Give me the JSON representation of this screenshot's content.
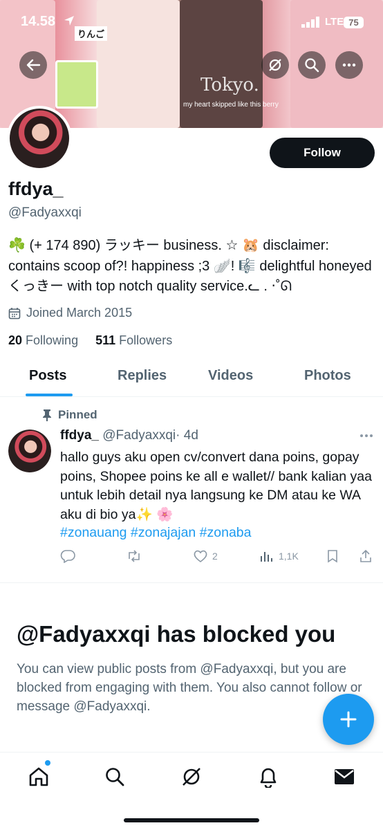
{
  "status_bar": {
    "time": "14.58",
    "network": "LTE",
    "battery": "75"
  },
  "banner": {
    "tags": [
      "りんご",
      "my heart skipped like this berry",
      "Tokyo."
    ]
  },
  "profile": {
    "display_name": "ffdya_",
    "handle": "@Fadyaxxqi",
    "bio": "☘️ (+ 174 890) ラッキー business. ☆ 🐹 disclaimer: contains scoop of?! happiness ;3 🪽! 🎼 delightful honeyed くっきー with top notch quality service.ᓚ . ‧˚ᘏ",
    "joined": "Joined March 2015",
    "following_count": "20",
    "following_label": "Following",
    "followers_count": "511",
    "followers_label": "Followers",
    "follow_button": "Follow"
  },
  "tabs": [
    "Posts",
    "Replies",
    "Videos",
    "Photos"
  ],
  "pinned_post": {
    "pinned_label": "Pinned",
    "author_name": "ffdya_",
    "author_handle": "@Fadyaxxqi",
    "time": "· 4d",
    "text": "hallo guys aku open cv/convert dana poins, gopay poins, Shopee poins ke all e wallet// bank kalian yaa untuk  lebih detail nya langsung ke DM atau ke WA aku di bio ya✨ 🌸",
    "hashtags": "#zonauang #zonajajan #zonaba",
    "likes": "2",
    "views": "1,1K"
  },
  "blocked": {
    "title": "@Fadyaxxqi has blocked you",
    "message": "You can view public posts from @Fadyaxxqi, but you are blocked from engaging with them. You also cannot follow or message @Fadyaxxqi."
  },
  "colors": {
    "accent": "#1d9bf0",
    "text": "#0f1419",
    "secondary": "#536471"
  },
  "icons": [
    "back-arrow-icon",
    "grok-icon",
    "search-icon",
    "more-icon",
    "calendar-icon",
    "pin-icon",
    "reply-icon",
    "repost-icon",
    "like-icon",
    "views-icon",
    "bookmark-icon",
    "share-icon",
    "plus-icon",
    "home-icon",
    "bell-icon",
    "mail-icon"
  ]
}
